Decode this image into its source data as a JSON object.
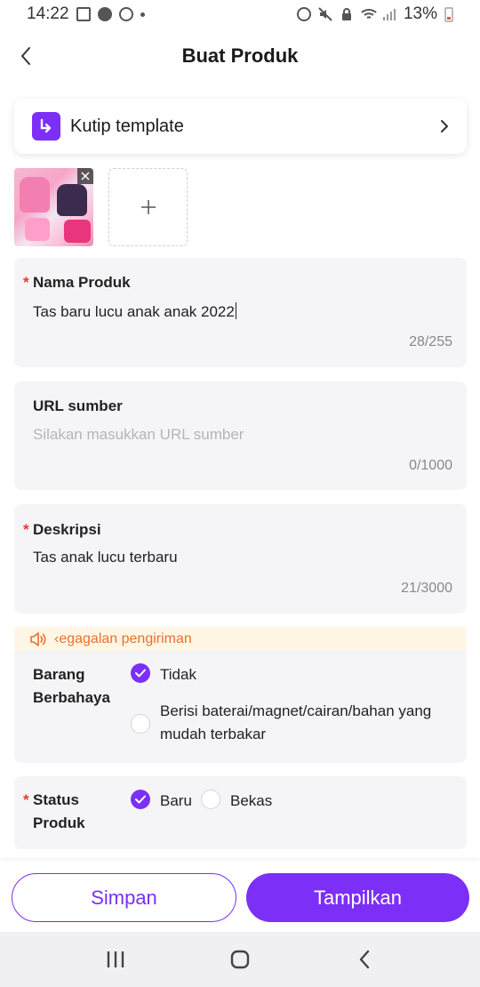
{
  "status_bar": {
    "time": "14:22",
    "battery": "13%"
  },
  "header": {
    "title": "Buat Produk"
  },
  "template": {
    "label": "Kutip template"
  },
  "fields": {
    "name": {
      "label": "Nama Produk",
      "value": "Tas baru lucu anak anak 2022",
      "counter": "28/255"
    },
    "url": {
      "label": "URL sumber",
      "placeholder": "Silakan masukkan URL sumber",
      "counter": "0/1000"
    },
    "description": {
      "label": "Deskripsi",
      "value": "Tas anak lucu terbaru",
      "counter": "21/3000"
    }
  },
  "notice": {
    "text": "‹egagalan pengiriman"
  },
  "dangerous": {
    "label": "Barang Berbahaya",
    "options": [
      {
        "label": "Tidak",
        "selected": true
      },
      {
        "label": "Berisi baterai/magnet/cairan/bahan yang mudah terbakar",
        "selected": false
      }
    ]
  },
  "status": {
    "label": "Status Produk",
    "options": [
      {
        "label": "Baru",
        "selected": true
      },
      {
        "label": "Bekas",
        "selected": false
      }
    ]
  },
  "buttons": {
    "save": "Simpan",
    "publish": "Tampilkan"
  },
  "colors": {
    "accent": "#7b2ff7",
    "required": "#e53935",
    "notice": "#e8712b"
  }
}
